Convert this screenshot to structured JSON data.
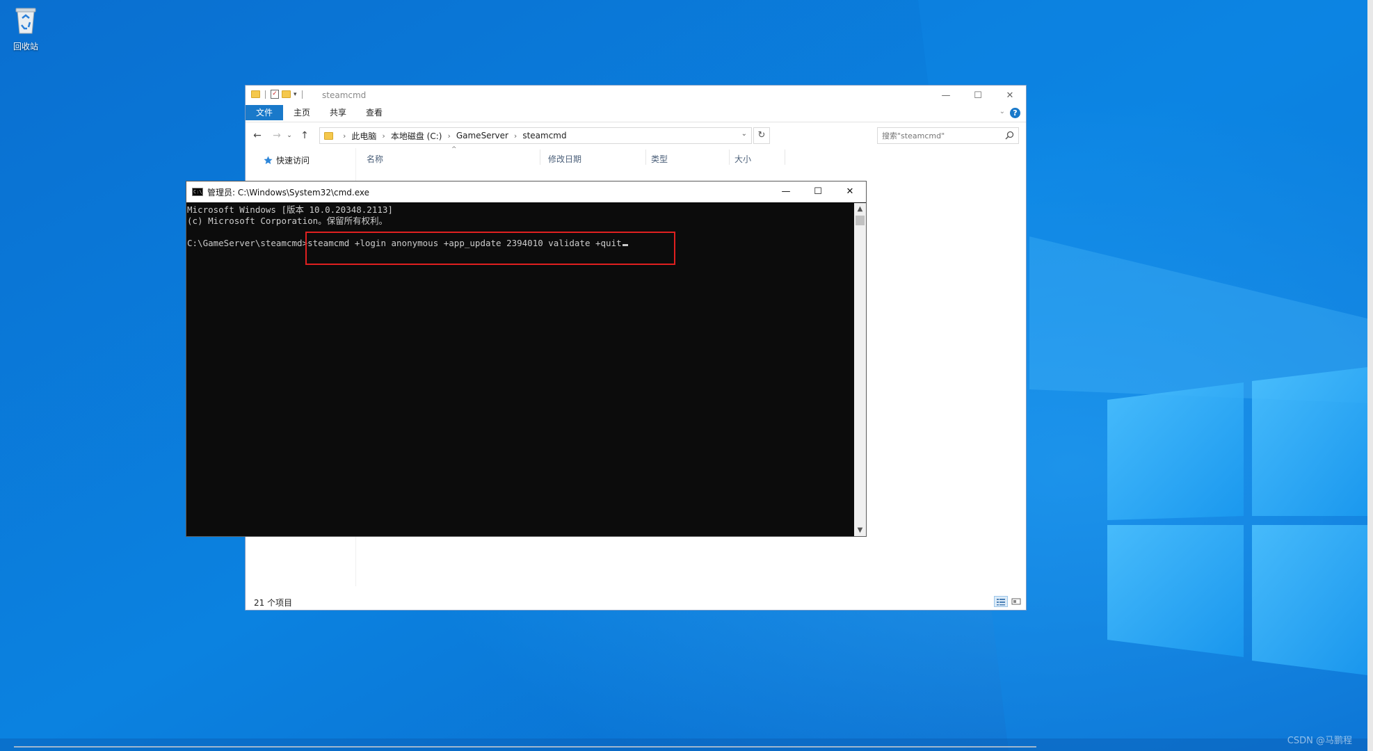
{
  "desktop": {
    "recycle_bin_label": "回收站"
  },
  "explorer": {
    "title": "steamcmd",
    "ribbon_tabs": [
      "文件",
      "主页",
      "共享",
      "查看"
    ],
    "breadcrumbs": [
      "此电脑",
      "本地磁盘 (C:)",
      "GameServer",
      "steamcmd"
    ],
    "search_placeholder": "搜索\"steamcmd\"",
    "quick_access_label": "快速访问",
    "columns": [
      "名称",
      "修改日期",
      "类型",
      "大小"
    ],
    "status_count": "21 个项目"
  },
  "cmd": {
    "title": "管理员: C:\\Windows\\System32\\cmd.exe",
    "lines": [
      "Microsoft Windows [版本 10.0.20348.2113]",
      "(c) Microsoft Corporation。保留所有权利。"
    ],
    "prompt": "C:\\GameServer\\steamcmd>",
    "command": "steamcmd +login anonymous +app_update 2394010 validate +quit"
  },
  "watermark": "CSDN @马鹏程",
  "colors": {
    "desktop_blue": "#0a78d7",
    "ribbon_accent": "#1979ca",
    "highlight_red": "#e02020",
    "console_bg": "#0c0c0c"
  },
  "icons": [
    "recycle-bin-icon",
    "folder-icon",
    "back-arrow-icon",
    "forward-arrow-icon",
    "up-arrow-icon",
    "refresh-icon",
    "search-icon",
    "star-icon",
    "help-icon",
    "minimize-icon",
    "maximize-icon",
    "close-icon"
  ]
}
